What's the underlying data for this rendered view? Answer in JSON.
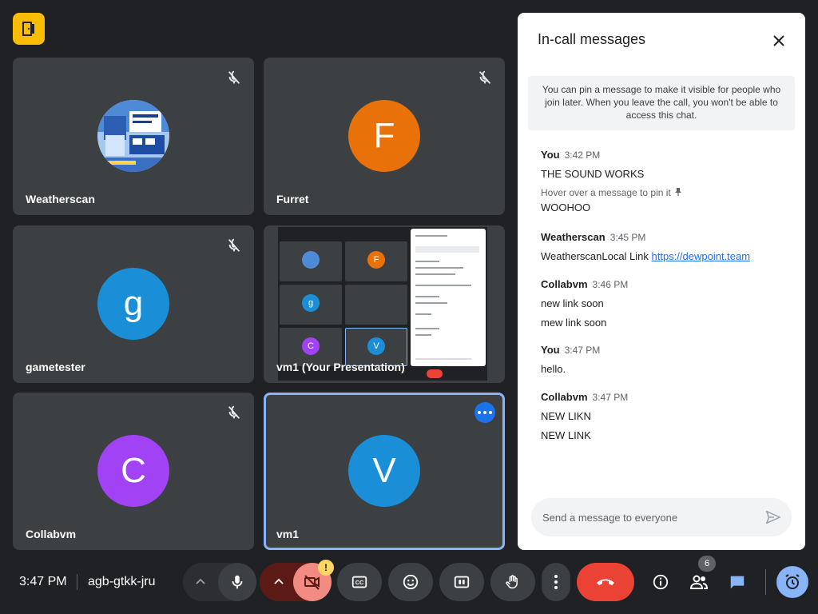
{
  "meeting": {
    "time": "3:47 PM",
    "code": "agb-gtkk-jru",
    "participant_count": "6"
  },
  "tiles": [
    {
      "name": "Weatherscan",
      "muted": true
    },
    {
      "name": "Furret",
      "initial": "F",
      "color": "#e8710a",
      "muted": true
    },
    {
      "name": "gametester",
      "initial": "g",
      "color": "#1a8fd8",
      "muted": true
    },
    {
      "name": "vm1 (Your Presentation)"
    },
    {
      "name": "Collabvm",
      "initial": "C",
      "color": "#a142f4",
      "muted": true
    },
    {
      "name": "vm1",
      "initial": "V",
      "color": "#1a8fd8",
      "active": true
    }
  ],
  "presentation_mini": {
    "initials": [
      "F",
      "g",
      "C",
      "V"
    ]
  },
  "chat": {
    "title": "In-call messages",
    "notice": "You can pin a message to make it visible for people who join later. When you leave the call, you won't be able to access this chat.",
    "pin_hint": "Hover over a message to pin it",
    "compose_placeholder": "Send a message to everyone",
    "groups": [
      {
        "sender": "You",
        "time": "3:42 PM",
        "messages": [
          "THE SOUND WORKS",
          "WOOHOO"
        ]
      },
      {
        "sender": "Weatherscan",
        "time": "3:45 PM",
        "text_prefix": "WeatherscanLocal Link ",
        "link": "https://dewpoint.team"
      },
      {
        "sender": "Collabvm",
        "time": "3:46 PM",
        "messages": [
          "new link soon",
          "mew link soon"
        ]
      },
      {
        "sender": "You",
        "time": "3:47 PM",
        "messages": [
          "hello."
        ]
      },
      {
        "sender": "Collabvm",
        "time": "3:47 PM",
        "messages": [
          "NEW LIKN",
          "NEW LINK"
        ]
      }
    ]
  },
  "colors": {
    "background": "#202124",
    "tile": "#3c4043",
    "accent": "#8ab4f8",
    "hangup": "#ea4335",
    "camera_off": "#f28b82"
  },
  "icons": [
    "app-logo-icon",
    "mic-off-icon",
    "mic-icon",
    "chevron-up-icon",
    "camera-off-icon",
    "captions-icon",
    "emoji-icon",
    "present-icon",
    "raise-hand-icon",
    "more-options-icon",
    "hang-up-icon",
    "info-icon",
    "people-icon",
    "chat-icon",
    "activities-icon",
    "close-icon",
    "send-icon",
    "pin-icon"
  ]
}
